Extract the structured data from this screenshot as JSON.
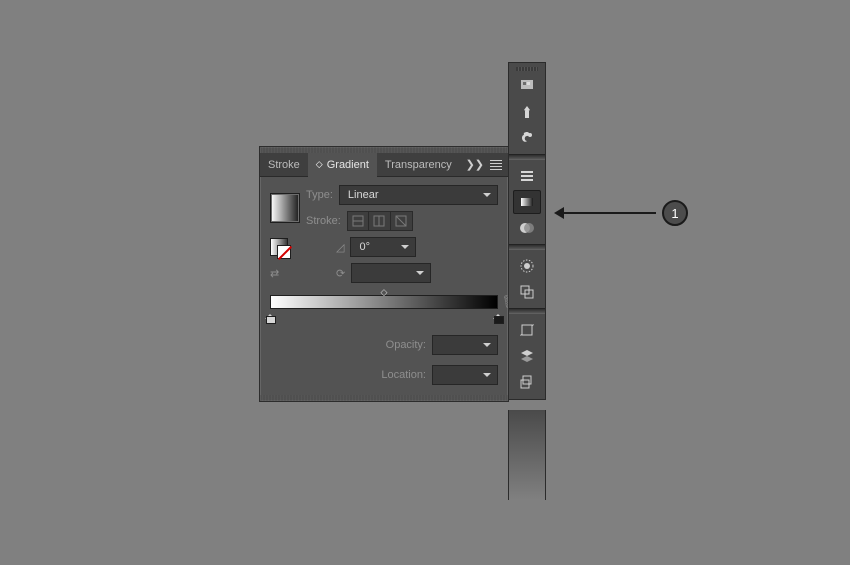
{
  "panel": {
    "tabs": {
      "stroke": "Stroke",
      "gradient": "Gradient",
      "transparency": "Transparency"
    },
    "collapse": "❯❯",
    "type_label": "Type:",
    "type_value": "Linear",
    "stroke_label": "Stroke:",
    "angle_value": "0°",
    "opacity_label": "Opacity:",
    "opacity_value": "",
    "location_label": "Location:",
    "location_value": ""
  },
  "callout": {
    "label": "1"
  },
  "icons": {
    "color": "color-panel-icon",
    "brushes": "brushes-icon",
    "symbols": "symbols-icon",
    "properties": "properties-icon",
    "gradient": "gradient-icon",
    "transparency": "transparency-icon",
    "appearance": "appearance-icon",
    "graphicstyles": "graphic-styles-icon",
    "transform": "transform-icon",
    "layers": "layers-icon",
    "artboards": "artboards-icon"
  }
}
